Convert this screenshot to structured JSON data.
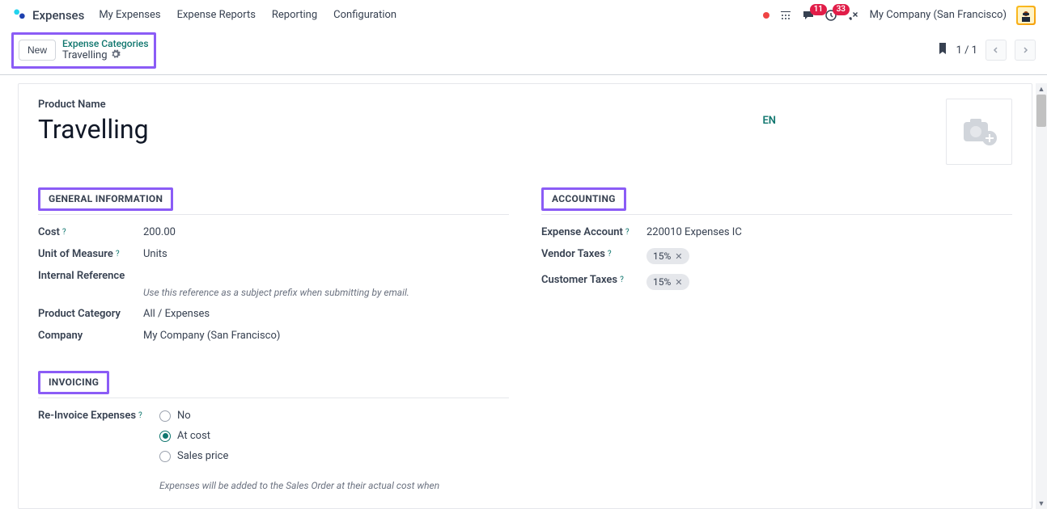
{
  "nav": {
    "app_name": "Expenses",
    "items": [
      "My Expenses",
      "Expense Reports",
      "Reporting",
      "Configuration"
    ],
    "messages_badge": "11",
    "activities_badge": "33",
    "company": "My Company (San Francisco)"
  },
  "control": {
    "new_label": "New",
    "breadcrumb_parent": "Expense Categories",
    "breadcrumb_current": "Travelling",
    "pager": "1 / 1"
  },
  "sheet": {
    "product_label": "Product Name",
    "product_name": "Travelling",
    "lang": "EN",
    "sections": {
      "general": "GENERAL INFORMATION",
      "accounting": "ACCOUNTING",
      "invoicing": "INVOICING"
    },
    "general": {
      "cost_label": "Cost",
      "cost_value": "200.00",
      "uom_label": "Unit of Measure",
      "uom_value": "Units",
      "internal_ref_label": "Internal Reference",
      "internal_ref_hint": "Use this reference as a subject prefix when submitting by email.",
      "category_label": "Product Category",
      "category_value": "All / Expenses",
      "company_label": "Company",
      "company_value": "My Company (San Francisco)"
    },
    "accounting": {
      "expense_account_label": "Expense Account",
      "expense_account_value": "220010 Expenses IC",
      "vendor_taxes_label": "Vendor Taxes",
      "vendor_taxes_value": "15%",
      "customer_taxes_label": "Customer Taxes",
      "customer_taxes_value": "15%"
    },
    "invoicing": {
      "reinvoice_label": "Re-Invoice Expenses",
      "options": {
        "no": "No",
        "at_cost": "At cost",
        "sales_price": "Sales price"
      },
      "hint": "Expenses will be added to the Sales Order at their actual cost when"
    }
  }
}
